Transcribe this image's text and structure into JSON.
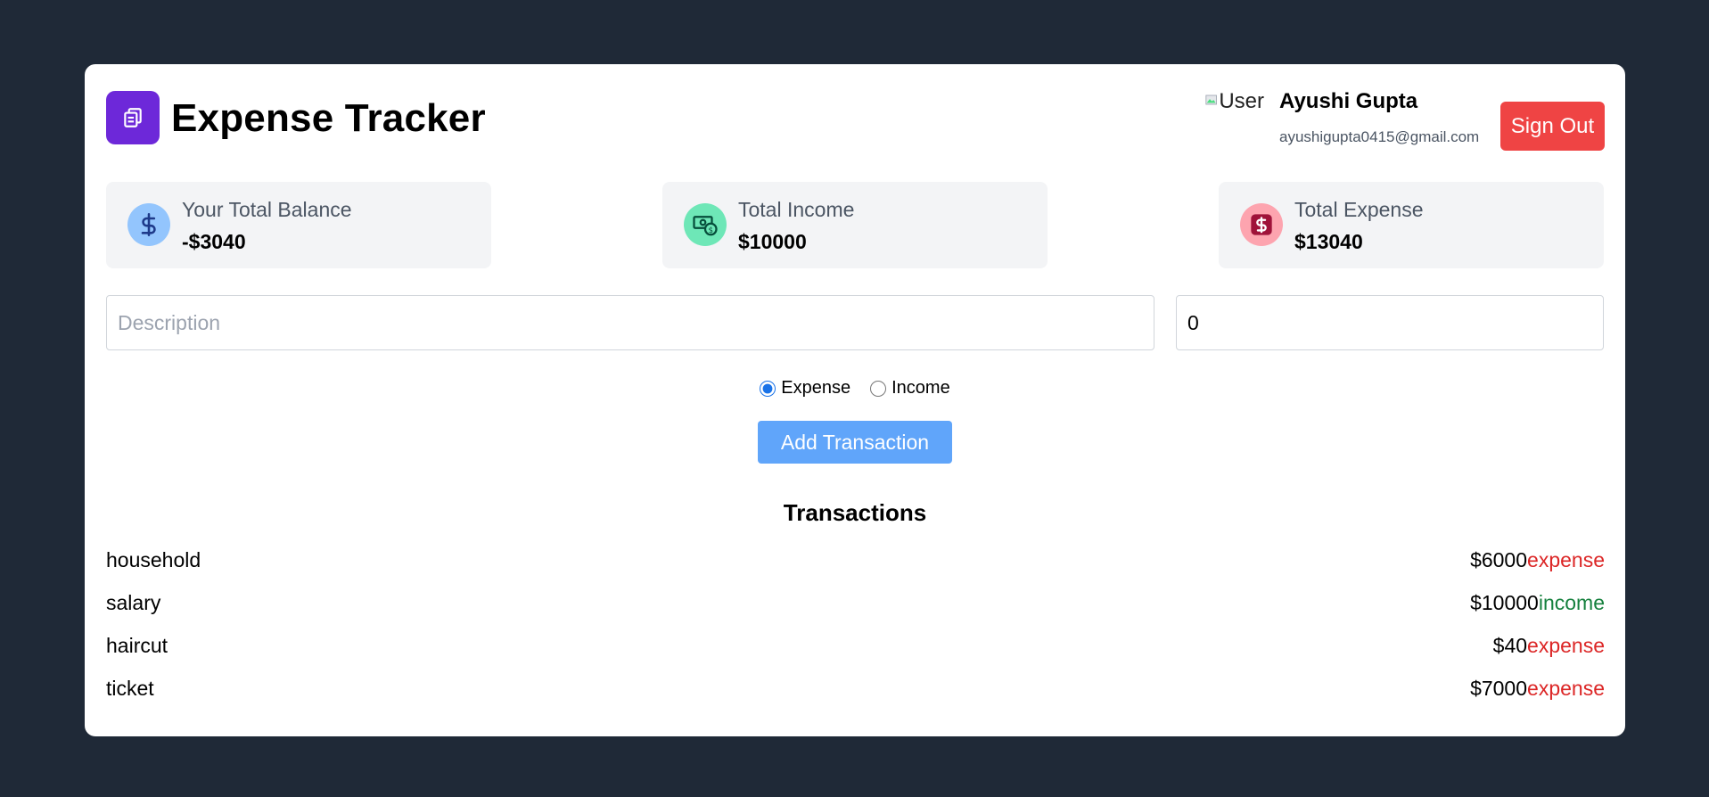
{
  "app": {
    "title": "Expense Tracker",
    "logo_icon": "wallet-icon"
  },
  "user": {
    "avatar_alt": "User",
    "name": "Ayushi Gupta",
    "email": "ayushigupta0415@gmail.com",
    "signout_label": "Sign Out"
  },
  "summary": {
    "balance": {
      "label": "Your Total Balance",
      "value": "-$3040",
      "icon": "dollar-icon",
      "icon_bg": "#93c5fd",
      "icon_color": "#1e3a8a"
    },
    "income": {
      "label": "Total Income",
      "value": "$10000",
      "icon": "money-bill-icon",
      "icon_bg": "#6ee7b7",
      "icon_color": "#065f46"
    },
    "expense": {
      "label": "Total Expense",
      "value": "$13040",
      "icon": "dollar-square-icon",
      "icon_bg": "#fda4af",
      "icon_color": "#9f1239"
    }
  },
  "form": {
    "description_placeholder": "Description",
    "amount_value": "0",
    "type_expense_label": "Expense",
    "type_income_label": "Income",
    "selected_type": "Expense",
    "add_label": "Add Transaction"
  },
  "transactions": {
    "heading": "Transactions",
    "items": [
      {
        "description": "household",
        "amount": "$6000",
        "type": "expense"
      },
      {
        "description": "salary",
        "amount": "$10000",
        "type": "income"
      },
      {
        "description": "haircut",
        "amount": "$40",
        "type": "expense"
      },
      {
        "description": "ticket",
        "amount": "$7000",
        "type": "expense"
      }
    ]
  },
  "colors": {
    "background": "#1f2937",
    "logo": "#6d28d9",
    "signout": "#ef4444",
    "add_button": "#60a5fa",
    "expense": "#dc2626",
    "income": "#15803d"
  }
}
